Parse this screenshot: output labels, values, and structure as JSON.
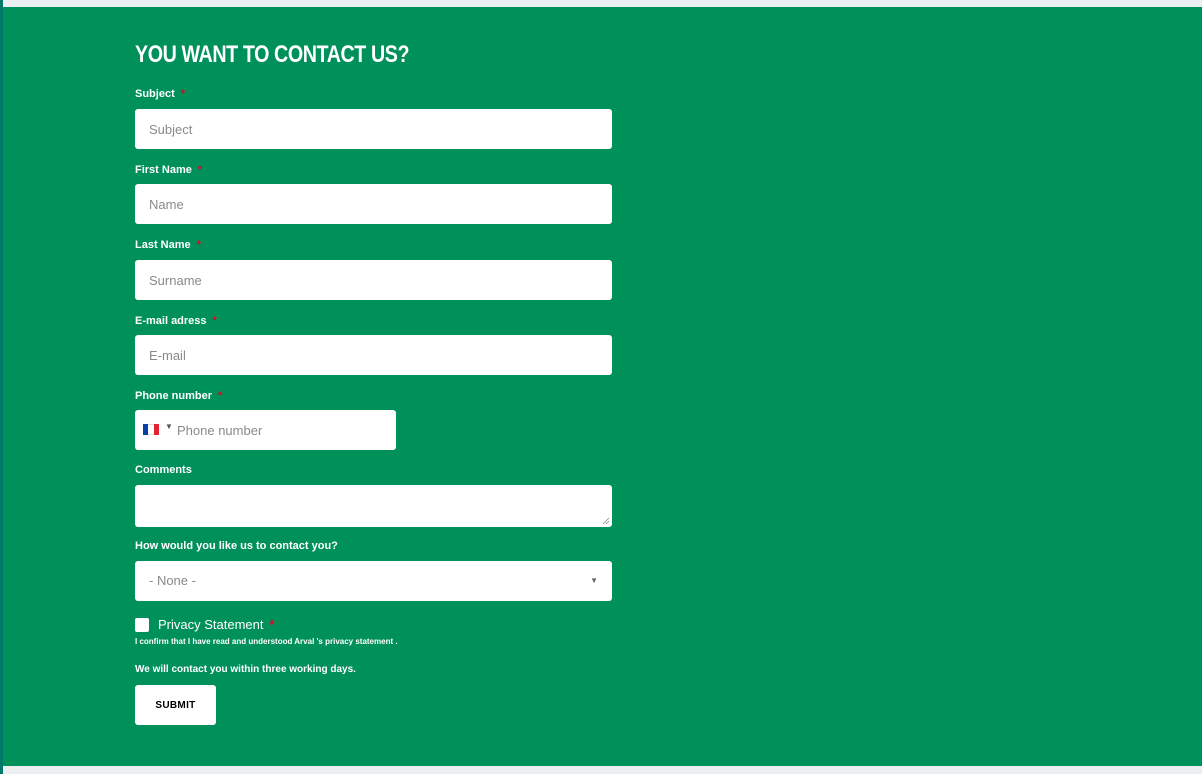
{
  "form": {
    "title": "YOU WANT TO CONTACT US?",
    "required_mark": "*",
    "subject": {
      "label": "Subject",
      "placeholder": "Subject"
    },
    "first_name": {
      "label": "First Name",
      "placeholder": "Name"
    },
    "last_name": {
      "label": "Last Name",
      "placeholder": "Surname"
    },
    "email": {
      "label": "E-mail adress",
      "placeholder": "E-mail"
    },
    "phone": {
      "label": "Phone number",
      "placeholder": "Phone number",
      "country_flag": "france-flag-icon"
    },
    "comments": {
      "label": "Comments"
    },
    "contact_method": {
      "label": "How would you like us to contact you?",
      "selected": "- None -",
      "icon": "caret-down-icon"
    },
    "privacy": {
      "label": "Privacy Statement",
      "note": "I confirm that I have read and understood Arval 's  privacy statement .",
      "checked": false
    },
    "contact_note": "We will contact you within three working days.",
    "submit_label": "SUBMIT"
  },
  "colors": {
    "panel_bg": "#00915a",
    "page_bg": "#eceff1",
    "required": "#e4002b",
    "left_strip": "#00786a"
  }
}
